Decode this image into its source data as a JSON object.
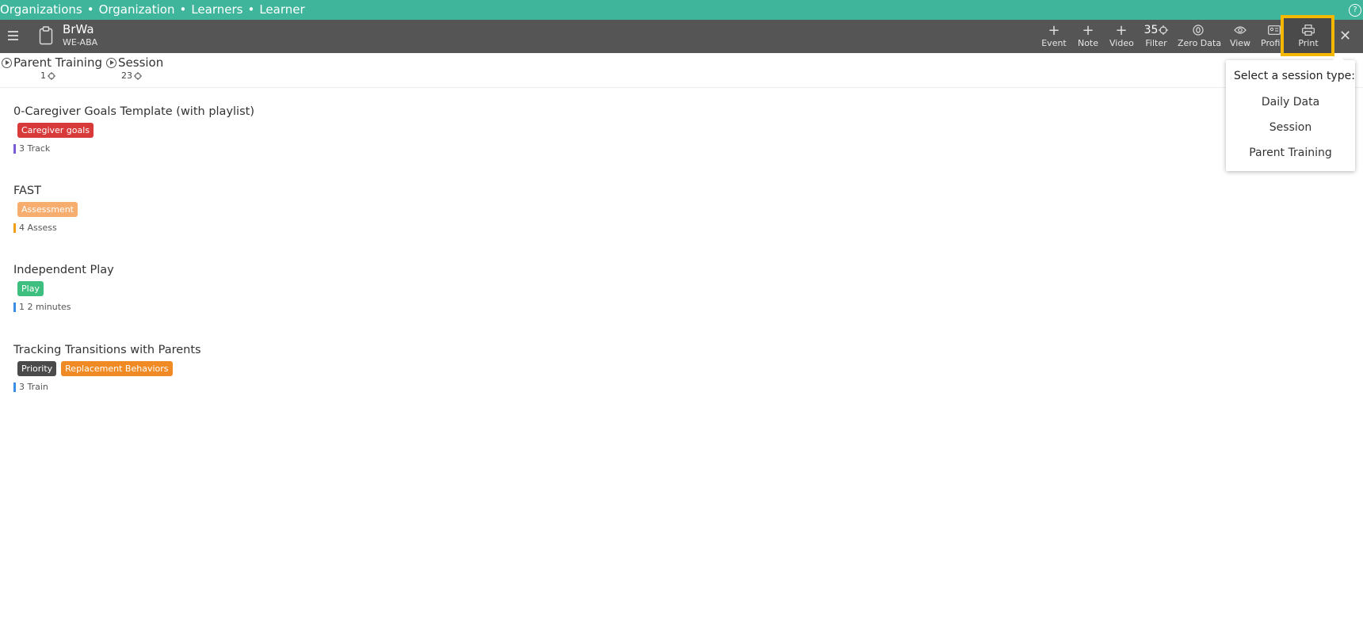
{
  "breadcrumbs": [
    "Organizations",
    "Organization",
    "Learners",
    "Learner"
  ],
  "breadcrumb_separator": "•",
  "help_icon": "question-circle-icon",
  "learner": {
    "name": "BrWa",
    "org": "WE-ABA"
  },
  "toolbar": {
    "event_label": "Event",
    "note_label": "Note",
    "video_label": "Video",
    "filter_count": "35",
    "filter_label": "Filter",
    "zero_data_label": "Zero Data",
    "view_label": "View",
    "profile_label": "Profile",
    "print_label": "Print"
  },
  "tabs": [
    {
      "label": "Parent Training",
      "count": "1"
    },
    {
      "label": "Session",
      "count": "23"
    }
  ],
  "goals": [
    {
      "title": "0-Caregiver Goals Template (with playlist)",
      "badges": [
        {
          "text": "Caregiver goals",
          "color": "#d83a3a"
        }
      ],
      "meta": "3 Track",
      "bar_color": "#7a5bd6"
    },
    {
      "title": "FAST",
      "badges": [
        {
          "text": "Assessment",
          "color": "#f7ad6e"
        }
      ],
      "meta": "4 Assess",
      "bar_color": "#f2a017"
    },
    {
      "title": "Independent Play",
      "badges": [
        {
          "text": "Play",
          "color": "#3fbf7f"
        }
      ],
      "meta": "1 2 minutes",
      "bar_color": "#3a8ee6"
    },
    {
      "title": "Tracking Transitions with Parents",
      "badges": [
        {
          "text": "Priority",
          "color": "#4a4a4a"
        },
        {
          "text": "Replacement Behaviors",
          "color": "#f08a24"
        }
      ],
      "meta": "3 Train",
      "bar_color": "#3a8ee6"
    }
  ],
  "dropdown": {
    "title": "Select a session type:",
    "options": [
      "Daily Data",
      "Session",
      "Parent Training"
    ]
  },
  "colors": {
    "header": "#3fb59b",
    "toolbar": "#555555",
    "highlight": "#f5b800"
  }
}
